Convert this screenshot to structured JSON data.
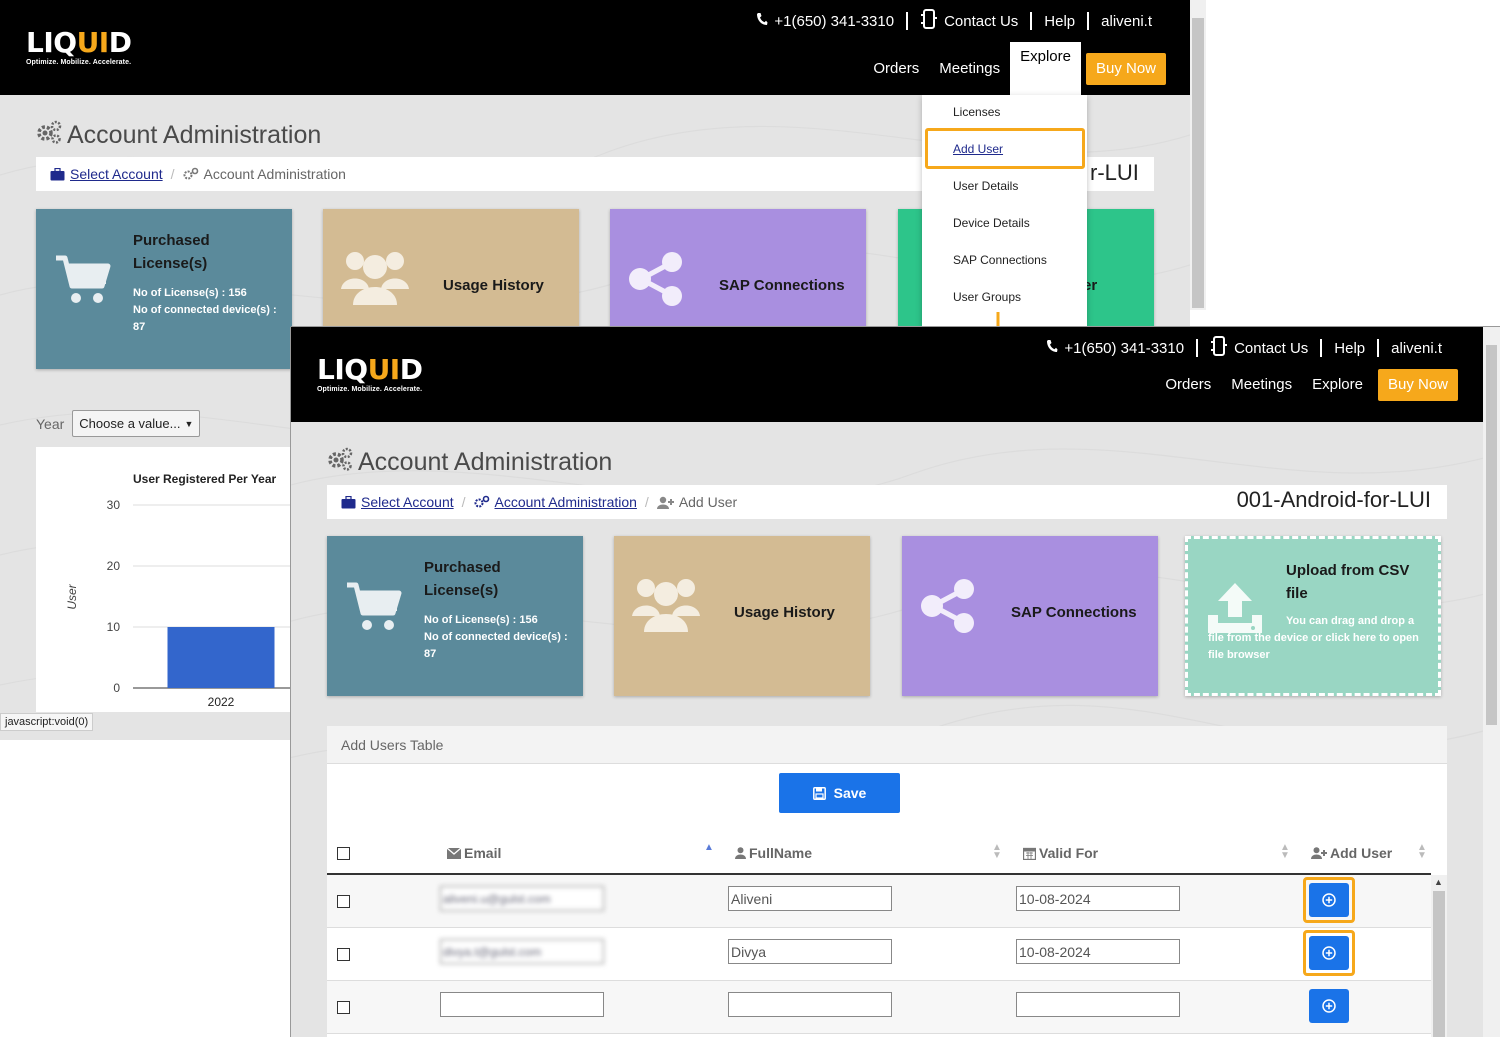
{
  "header": {
    "logo_main_a": "LIQ",
    "logo_main_b": "UI",
    "logo_main_c": "D",
    "logo_tagline": "Optimize. Mobilize. Accelerate.",
    "phone": "+1(650) 341-3310",
    "contact": "Contact Us",
    "help": "Help",
    "user": "aliveni.t",
    "nav": [
      "Orders",
      "Meetings",
      "Explore"
    ],
    "buy_now": "Buy Now"
  },
  "back": {
    "page_title": "Account Administration",
    "breadcrumb": [
      "Select Account",
      "Account Administration"
    ],
    "account_name_partial": "r-LUI",
    "tiles": {
      "licenses_title": "Purchased License(s)",
      "licenses_line1": "No of License(s) : 156",
      "licenses_line2": "No of connected device(s) : 87",
      "usage": "Usage History",
      "sap": "SAP Connections",
      "partial": "er"
    },
    "year_label": "Year",
    "year_select": "Choose a value...",
    "status_text": "javascript:void(0)"
  },
  "explore_menu": [
    "Licenses",
    "Add User",
    "User Details",
    "Device Details",
    "SAP Connections",
    "User Groups"
  ],
  "front": {
    "page_title": "Account Administration",
    "breadcrumb": [
      "Select Account",
      "Account Administration",
      "Add User"
    ],
    "account_name": "001-Android-for-LUI",
    "tiles": {
      "licenses_title": "Purchased License(s)",
      "licenses_line1": "No of License(s) : 156",
      "licenses_line2": "No of connected device(s) : 87",
      "usage": "Usage History",
      "sap": "SAP Connections",
      "upload_title": "Upload from CSV file",
      "upload_desc": "You can drag and drop a file from the device or click here to open file browser"
    },
    "table": {
      "title": "Add Users Table",
      "save": "Save",
      "columns": [
        "Email",
        "FullName",
        "Valid For",
        "Add User"
      ],
      "rows": [
        {
          "email": "aliveni.u@gulst.com",
          "name": "Aliveni",
          "valid": "10-08-2024"
        },
        {
          "email": "divya.t@gulst.com",
          "name": "Divya",
          "valid": "10-08-2024"
        },
        {
          "email": "",
          "name": "",
          "valid": ""
        }
      ]
    }
  },
  "chart_data": {
    "type": "bar",
    "title": "User Registered Per Year",
    "ylabel": "User",
    "xlabel": "",
    "categories": [
      "2022"
    ],
    "values": [
      10
    ],
    "ylim": [
      0,
      30
    ],
    "yticks": [
      0,
      10,
      20,
      30
    ],
    "bar_color": "#3366cc",
    "grid": true
  },
  "colors": {
    "accent": "#f6a81b",
    "primary_button": "#1a73e8",
    "tile_licenses": "#5b8a9b",
    "tile_usage": "#d3bb93",
    "tile_sap": "#a98fe0",
    "tile_upload": "#99d6c3",
    "tile_green": "#2dc58a"
  }
}
